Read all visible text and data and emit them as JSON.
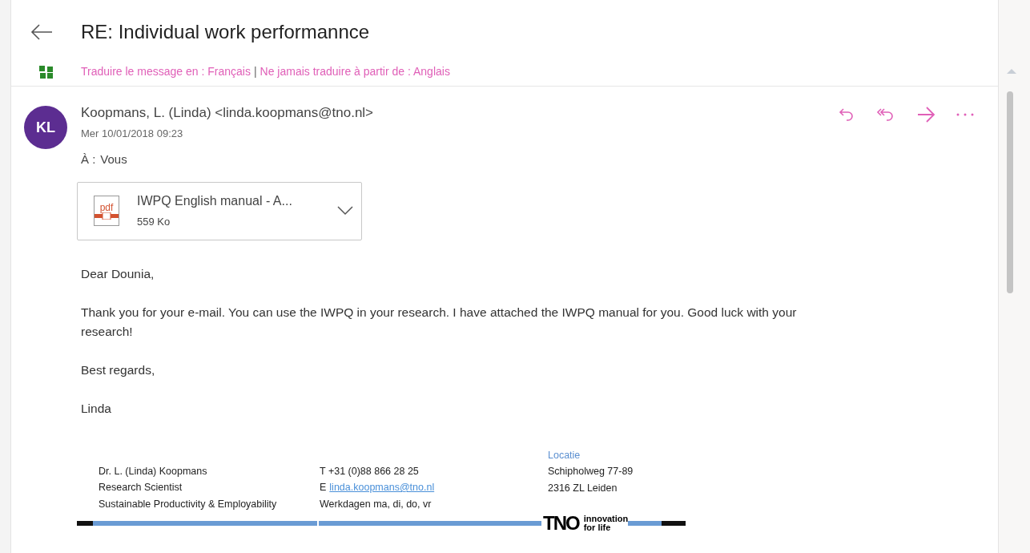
{
  "header": {
    "title": "RE: Individual work performannce",
    "translate_links": [
      "Traduire le message en : Français",
      "Ne jamais traduire à partir de : Anglais"
    ],
    "separator": "|"
  },
  "message": {
    "avatar": {
      "initials": "KL",
      "color": "#5c2d91"
    },
    "sender": "Koopmans, L. (Linda) <linda.koopmans@tno.nl>",
    "date": "Mer 10/01/2018 09:23",
    "to_label": "À :",
    "to": "Vous",
    "attachment": {
      "name": "IWPQ English manual - A...",
      "size": "559 Ko",
      "icon_text": "pdf"
    },
    "body": [
      "Dear Dounia,",
      "Thank you for your e-mail. You can use the IWPQ in your research. I have attached the IWPQ manual for you. Good luck with your research!",
      "Best regards,",
      "Linda"
    ],
    "signature": {
      "column_1": [
        "Dr. L. (Linda) Koopmans",
        "Research Scientist",
        "Sustainable Productivity & Employability"
      ],
      "column_2": [
        {
          "kind": "text",
          "text": "T +31 (0)88 866 28 25"
        },
        {
          "kind": "link",
          "prefix": "E",
          "text": "linda.koopmans@tno.nl"
        },
        {
          "kind": "text",
          "text": "Werkdagen ma, di, do, vr"
        }
      ],
      "column_3": {
        "heading": "Locatie",
        "lines": [
          "Schipholweg 77-89",
          "2316 ZL Leiden"
        ]
      },
      "logo": {
        "mark": "TNO",
        "tagline_1": "innovation",
        "tagline_2": "for life"
      }
    }
  }
}
